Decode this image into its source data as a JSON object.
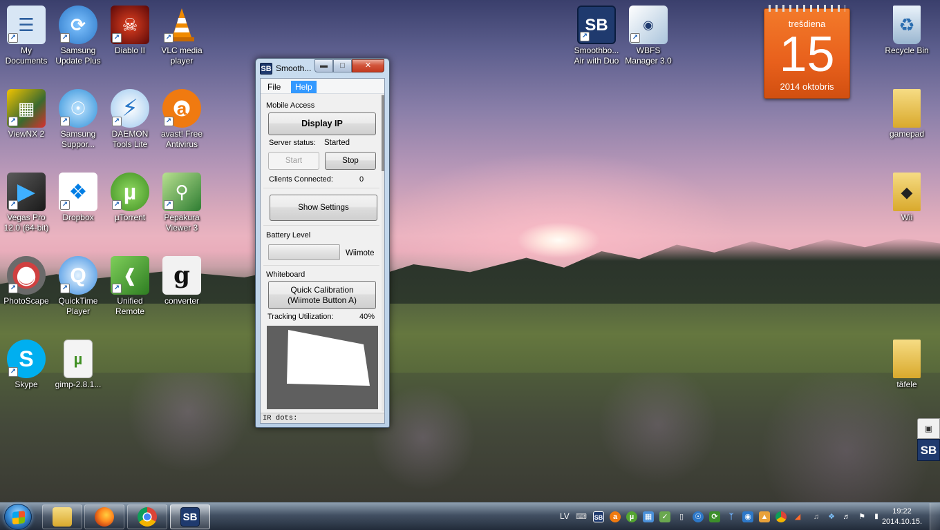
{
  "desktop_icons": [
    {
      "label": "My Documents",
      "icon": "documents-icon",
      "color": "#d8e6f5"
    },
    {
      "label": "Samsung Update Plus",
      "icon": "globe-arrow-icon",
      "color": "#2d78c8"
    },
    {
      "label": "Diablo II",
      "icon": "demon-icon",
      "color": "#8b1010"
    },
    {
      "label": "VLC media player",
      "icon": "traffic-cone-icon",
      "color": "#f08a00"
    },
    {
      "label": "ViewNX 2",
      "icon": "photo-viewer-icon",
      "color": "#3b6a2e"
    },
    {
      "label": "Samsung Suppor...",
      "icon": "support-globe-icon",
      "color": "#2f8fd8"
    },
    {
      "label": "DAEMON Tools Lite",
      "icon": "lightning-icon",
      "color": "#2a78c8"
    },
    {
      "label": "avast! Free Antivirus",
      "icon": "avast-icon",
      "color": "#f07a10"
    },
    {
      "label": "Vegas Pro 12.0 (64-bit)",
      "icon": "play-icon",
      "color": "#2c2c2c"
    },
    {
      "label": "Dropbox",
      "icon": "dropbox-icon",
      "color": "#ffffff"
    },
    {
      "label": "µTorrent",
      "icon": "utorrent-icon",
      "color": "#54a531"
    },
    {
      "label": "Pepakura Viewer 3",
      "icon": "pepakura-icon",
      "color": "#3a8c3a"
    },
    {
      "label": "PhotoScape",
      "icon": "photoscape-icon",
      "color": "#7a7a7a"
    },
    {
      "label": "QuickTime Player",
      "icon": "quicktime-icon",
      "color": "#3a8ce0"
    },
    {
      "label": "Unified Remote",
      "icon": "wifi-icon",
      "color": "#3c8f2a"
    },
    {
      "label": "converter",
      "icon": "converter-icon",
      "color": "#f2f2f2"
    },
    {
      "label": "Skype",
      "icon": "skype-icon",
      "color": "#00aff0"
    },
    {
      "label": "gimp-2.8.1...",
      "icon": "torrent-file-icon",
      "color": "#f4f4f4"
    },
    {
      "label": "Smoothbo... Air with Duo",
      "icon": "sb-icon",
      "color": "#1f3a6e"
    },
    {
      "label": "WBFS Manager 3.0",
      "icon": "wbfs-icon",
      "color": "#e8eef4"
    },
    {
      "label": "Recycle Bin",
      "icon": "recycle-bin-icon",
      "color": "#cfe0ee"
    },
    {
      "label": "gamepad",
      "icon": "folder-icon",
      "color": "#e8c454"
    },
    {
      "label": "Wii",
      "icon": "folder-icon",
      "color": "#e8c454"
    },
    {
      "label": "täfele",
      "icon": "folder-icon",
      "color": "#e8c454"
    }
  ],
  "calendar": {
    "weekday": "trešdiena",
    "day": "15",
    "month_year": "2014 oktobris"
  },
  "window": {
    "title": "Smooth...",
    "app_icon_text": "SB",
    "menu": {
      "file": "File",
      "help": "Help"
    },
    "mobile_access": {
      "label": "Mobile Access",
      "display_ip": "Display IP",
      "server_status_label": "Server status:",
      "server_status_value": "Started",
      "start": "Start",
      "stop": "Stop",
      "clients_label": "Clients Connected:",
      "clients_value": "0"
    },
    "show_settings": "Show Settings",
    "battery": {
      "label": "Battery Level",
      "device": "Wiimote",
      "level_percent": 0
    },
    "whiteboard": {
      "label": "Whiteboard",
      "calibration_line1": "Quick Calibration",
      "calibration_line2": "(Wiimote Button A)",
      "tracking_label": "Tracking Utilization:",
      "tracking_value": "40%"
    },
    "ir_dots_label": "IR dots:"
  },
  "side_gadget": {
    "text": "SB"
  },
  "taskbar": {
    "pinned": [
      {
        "name": "explorer",
        "icon": "folder-icon",
        "color": "#e8c454"
      },
      {
        "name": "firefox",
        "icon": "firefox-icon",
        "color": "#e66000"
      },
      {
        "name": "chrome",
        "icon": "chrome-icon",
        "color": "#4285f4"
      },
      {
        "name": "smoothboard",
        "icon": "sb-icon",
        "color": "#1f3a6e",
        "text": "SB"
      }
    ],
    "language": "LV",
    "tray_icon_sb": "SB",
    "time": "19:22",
    "date": "2014.10.15."
  }
}
